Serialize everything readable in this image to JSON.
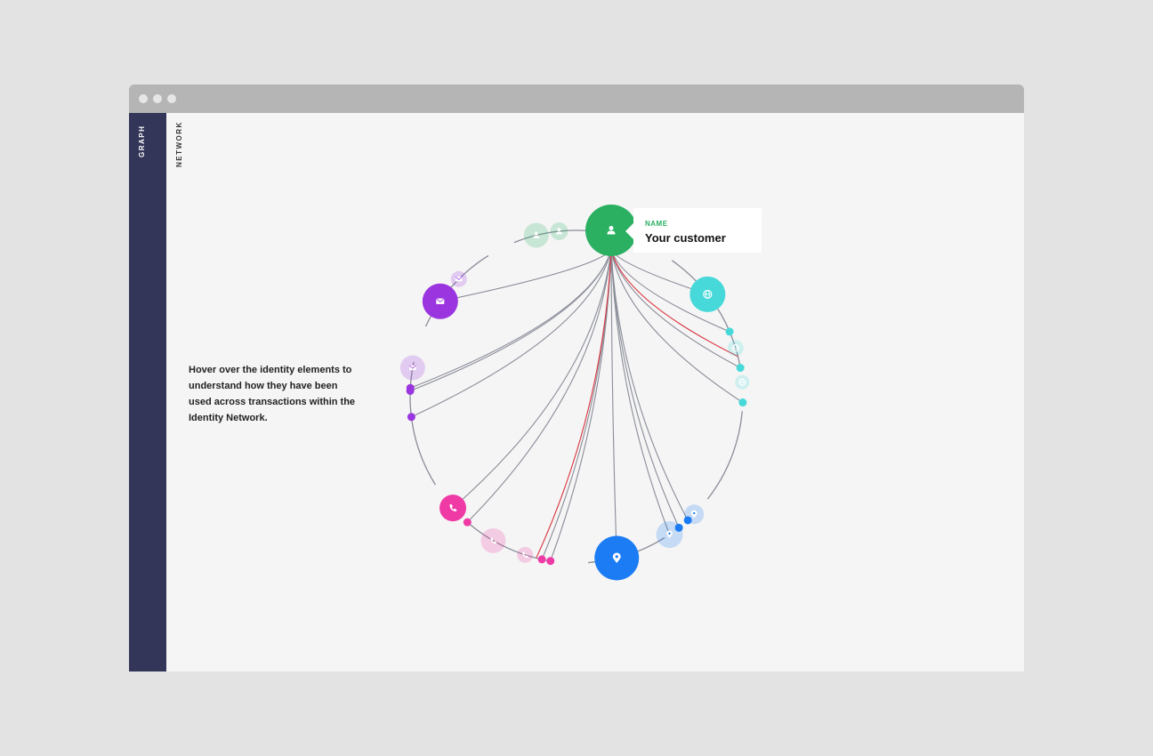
{
  "sidebar": {
    "label": "GRAPH"
  },
  "section": {
    "label": "NETWORK"
  },
  "hint": "Hover over the identity elements to understand how they have been used across transactions within the Identity Network.",
  "tooltip": {
    "label": "NAME",
    "value": "Your customer"
  },
  "colors": {
    "name": "#2bb062",
    "web": "#47d9d9",
    "email": "#9a35e0",
    "phone": "#ef3aa6",
    "location": "#1b7cf3",
    "sidebar": "#343659",
    "link": "#8a8d99",
    "alert_link": "#d9343f"
  },
  "nodes": [
    {
      "type": "name",
      "icon": "person-icon",
      "primary": true
    },
    {
      "type": "name",
      "icon": "person-icon",
      "primary": false
    },
    {
      "type": "name",
      "icon": "person-icon",
      "primary": false
    },
    {
      "type": "web",
      "icon": "globe-icon",
      "primary": true
    },
    {
      "type": "web",
      "icon": "globe-icon",
      "primary": false
    },
    {
      "type": "web",
      "icon": "globe-icon",
      "primary": false
    },
    {
      "type": "email",
      "icon": "envelope-icon",
      "primary": true
    },
    {
      "type": "email",
      "icon": "envelope-icon",
      "primary": false
    },
    {
      "type": "email",
      "icon": "envelope-icon",
      "primary": false
    },
    {
      "type": "phone",
      "icon": "phone-icon",
      "primary": true
    },
    {
      "type": "phone",
      "icon": "phone-icon",
      "primary": false
    },
    {
      "type": "phone",
      "icon": "phone-icon",
      "primary": false
    },
    {
      "type": "location",
      "icon": "map-pin-icon",
      "primary": true
    },
    {
      "type": "location",
      "icon": "map-pin-icon",
      "primary": false
    },
    {
      "type": "location",
      "icon": "map-pin-icon",
      "primary": false
    }
  ]
}
